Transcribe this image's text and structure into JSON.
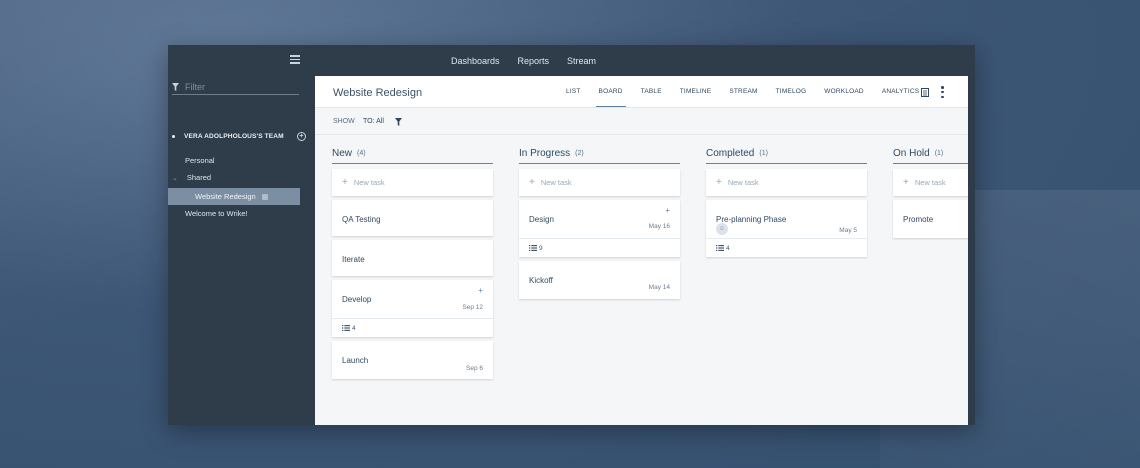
{
  "topnav": {
    "links": [
      "Dashboards",
      "Reports",
      "Stream"
    ]
  },
  "sidebar": {
    "filter_placeholder": "Filter",
    "team_name": "VERA ADOLPHOLOUS'S TEAM",
    "items": {
      "personal": "Personal",
      "shared": "Shared",
      "active_project": "Website Redesign",
      "welcome": "Welcome to Wrike!"
    }
  },
  "main": {
    "title": "Website Redesign",
    "views": [
      "LIST",
      "BOARD",
      "TABLE",
      "TIMELINE",
      "STREAM",
      "TIMELOG",
      "WORKLOAD",
      "ANALYTICS"
    ],
    "active_view": "BOARD",
    "toolbar": {
      "show_label": "SHOW",
      "to_label": "TO: All"
    }
  },
  "board": {
    "new_task_label": "New task",
    "columns": [
      {
        "name": "New",
        "count": "(4)",
        "cards": [
          {
            "title": "QA Testing",
            "date": "",
            "subtasks": "",
            "plus": false
          },
          {
            "title": "Iterate",
            "date": "",
            "subtasks": "",
            "plus": false
          },
          {
            "title": "Develop",
            "date": "Sep 12",
            "subtasks": "4",
            "plus": true
          },
          {
            "title": "Launch",
            "date": "Sep 6",
            "subtasks": "",
            "plus": false
          }
        ]
      },
      {
        "name": "In Progress",
        "count": "(2)",
        "cards": [
          {
            "title": "Design",
            "date": "May 16",
            "subtasks": "9",
            "plus": true
          },
          {
            "title": "Kickoff",
            "date": "May 14",
            "subtasks": "",
            "plus": false
          }
        ]
      },
      {
        "name": "Completed",
        "count": "(1)",
        "cards": [
          {
            "title": "Pre-planning Phase",
            "date": "May 5",
            "subtasks": "4",
            "plus": false,
            "avatar": true
          }
        ]
      },
      {
        "name": "On Hold",
        "count": "(1)",
        "cards": [
          {
            "title": "Promote",
            "date": "",
            "subtasks": "",
            "plus": false
          }
        ]
      }
    ]
  },
  "colors": {
    "accent": "#5e7fa0",
    "sidebar_bg": "#2f3d4b",
    "active_item": "#7b8ea2",
    "background": "#3d5676"
  }
}
